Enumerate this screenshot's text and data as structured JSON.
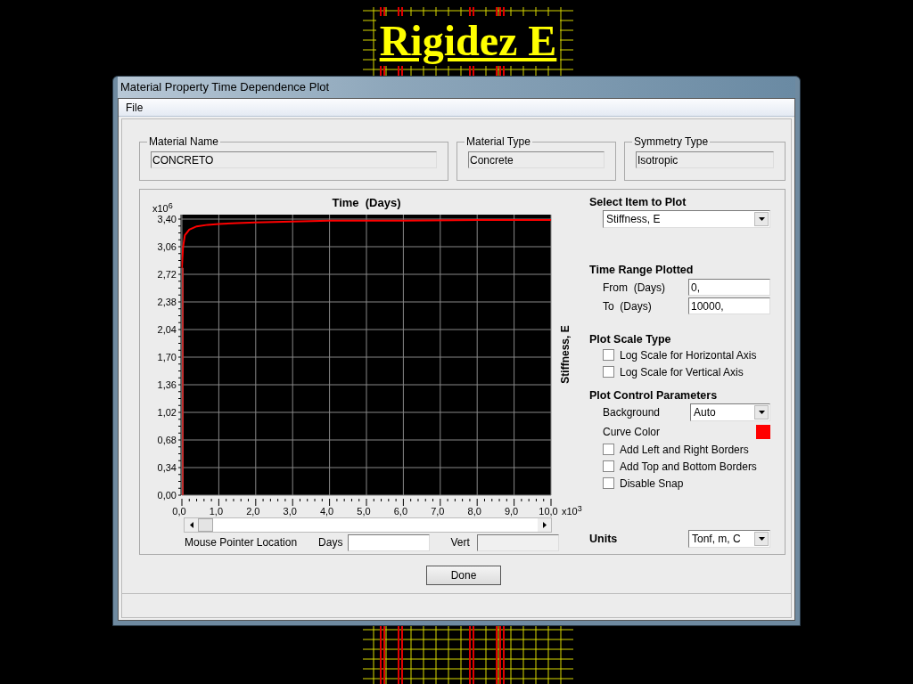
{
  "slide": {
    "title": "Rigidez E"
  },
  "window": {
    "title": "Material Property Time Dependence Plot"
  },
  "menu": [
    "File"
  ],
  "groups": [
    {
      "label": "Material Name",
      "value": "CONCRETO"
    },
    {
      "label": "Material Type",
      "value": "Concrete"
    },
    {
      "label": "Symmetry Type",
      "value": "Isotropic"
    }
  ],
  "plot": {
    "y_multiplier": {
      "base": "x10",
      "exponent": "6"
    },
    "x_multiplier": {
      "base": "x10",
      "exponent": "3"
    },
    "chart_data": {
      "type": "line",
      "title": "Time  (Days)",
      "ylabel": "Stiffness, E",
      "x": [
        0,
        0.03,
        0.08,
        0.2,
        0.4,
        0.7,
        1,
        1.5,
        2,
        3,
        4,
        6,
        8,
        10
      ],
      "grid": true,
      "series": [
        {
          "color": "#ff0000",
          "values": [
            2.8,
            3.05,
            3.2,
            3.27,
            3.31,
            3.33,
            3.34,
            3.35,
            3.36,
            3.37,
            3.38,
            3.38,
            3.39,
            3.39
          ]
        }
      ],
      "xlim": [
        0,
        10
      ],
      "ylim": [
        0,
        3.4
      ],
      "xticks": [
        {
          "value": 0,
          "label": "0,0"
        },
        {
          "value": 1,
          "label": "1,0"
        },
        {
          "value": 2,
          "label": "2,0"
        },
        {
          "value": 3,
          "label": "3,0"
        },
        {
          "value": 4,
          "label": "4,0"
        },
        {
          "value": 5,
          "label": "5,0"
        },
        {
          "value": 6,
          "label": "6,0"
        },
        {
          "value": 7,
          "label": "7,0"
        },
        {
          "value": 8,
          "label": "8,0"
        },
        {
          "value": 9,
          "label": "9,0"
        },
        {
          "value": 10,
          "label": "10,0"
        }
      ],
      "yticks": [
        {
          "value": 0,
          "label": "0,00"
        },
        {
          "value": 0.34,
          "label": "0,34"
        },
        {
          "value": 0.68,
          "label": "0,68"
        },
        {
          "value": 1.02,
          "label": "1,02"
        },
        {
          "value": 1.36,
          "label": "1,36"
        },
        {
          "value": 1.7,
          "label": "1,70"
        },
        {
          "value": 2.04,
          "label": "2,04"
        },
        {
          "value": 2.38,
          "label": "2,38"
        },
        {
          "value": 2.72,
          "label": "2,72"
        },
        {
          "value": 3.06,
          "label": "3,06"
        },
        {
          "value": 3.4,
          "label": "3,40"
        }
      ]
    },
    "pointer": {
      "label": "Mouse Pointer Location",
      "days_label": "Days",
      "days_disabled": false,
      "vert_label": "Vert",
      "vert_disabled": true
    }
  },
  "select_item": {
    "heading": "Select Item to Plot",
    "value": "Stiffness, E"
  },
  "time_range": {
    "heading": "Time Range Plotted",
    "from_label": "From  (Days)",
    "from_value": "0,",
    "to_label": "To  (Days)",
    "to_value": "10000,"
  },
  "scale": {
    "heading": "Plot Scale Type",
    "options": [
      {
        "label": "Log Scale for Horizontal Axis",
        "checked": false
      },
      {
        "label": "Log Scale for Vertical Axis",
        "checked": false
      }
    ]
  },
  "control": {
    "heading": "Plot Control Parameters",
    "background_label": "Background",
    "background_value": "Auto",
    "curve_color_label": "Curve Color",
    "curve_color_swatch": {
      "color": "#ff0000"
    },
    "options": [
      {
        "label": "Add Left and Right Borders",
        "checked": false
      },
      {
        "label": "Add Top and Bottom Borders",
        "checked": false
      },
      {
        "label": "Disable Snap",
        "checked": false
      }
    ]
  },
  "units": {
    "label": "Units",
    "value": "Tonf, m, C"
  },
  "done": "Done"
}
